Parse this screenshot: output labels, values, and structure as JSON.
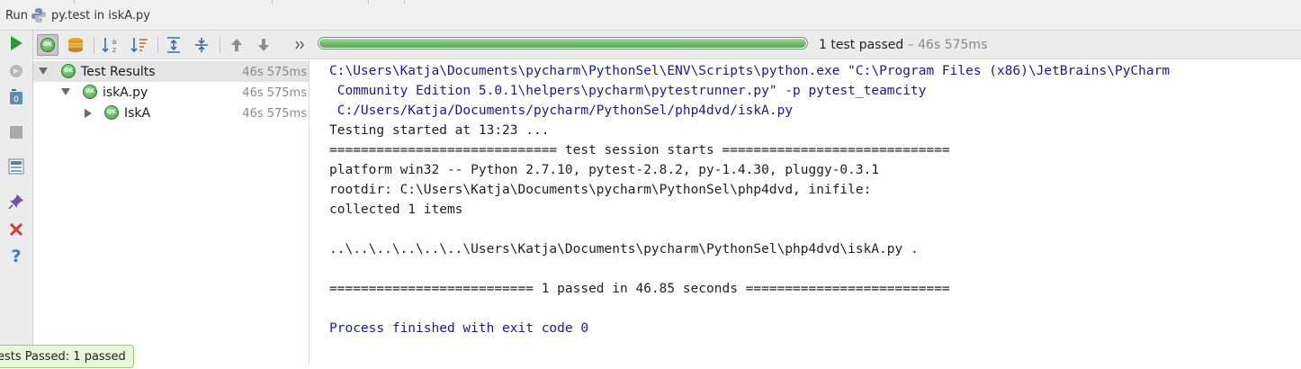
{
  "title_bar": {
    "run_label": "Run",
    "config_name": "py.test in iskA.py"
  },
  "toolbar": {
    "progress": 1.0,
    "status": "1 test passed",
    "status_time": " – 46s 575ms"
  },
  "tree": {
    "rows": [
      {
        "label": "Test Results",
        "time": "46s 575ms"
      },
      {
        "label": "iskA.py",
        "time": "46s 575ms"
      },
      {
        "label": "IskA",
        "time": "46s 575ms"
      }
    ],
    "ok_badge": "OK"
  },
  "console": {
    "lines": [
      "C:\\Users\\Katja\\Documents\\pycharm\\PythonSel\\ENV\\Scripts\\python.exe \"C:\\Program Files (x86)\\JetBrains\\PyCharm",
      " Community Edition 5.0.1\\helpers\\pycharm\\pytestrunner.py\" -p pytest_teamcity",
      " C:/Users/Katja/Documents/pycharm/PythonSel/php4dvd/iskA.py",
      "Testing started at 13:23 ...",
      "============================= test session starts =============================",
      "platform win32 -- Python 2.7.10, pytest-2.8.2, py-1.4.30, pluggy-0.3.1",
      "rootdir: C:\\Users\\Katja\\Documents\\pycharm\\PythonSel\\php4dvd, inifile:",
      "collected 1 items",
      "",
      "..\\..\\..\\..\\..\\..\\Users\\Katja\\Documents\\pycharm\\PythonSel\\php4dvd\\iskA.py .",
      "",
      "========================== 1 passed in 46.85 seconds ==========================",
      "",
      "Process finished with exit code 0"
    ]
  },
  "balloon": {
    "text": "ests Passed: 1 passed"
  },
  "colors": {
    "accent_green": "#5aa85a",
    "command_blue": "#1a1a8c"
  }
}
